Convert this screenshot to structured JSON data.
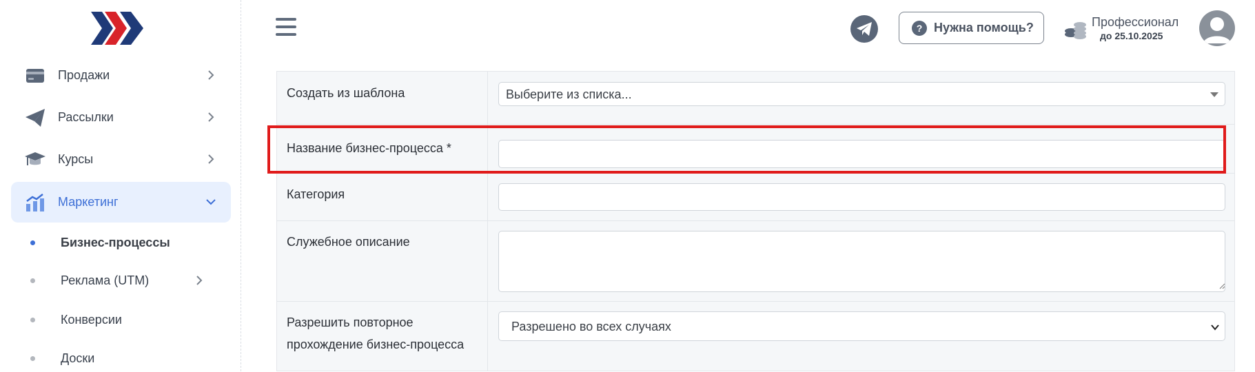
{
  "sidebar": {
    "items": [
      {
        "label": "Продажи",
        "icon": "credit-card-icon"
      },
      {
        "label": "Рассылки",
        "icon": "paper-plane-icon"
      },
      {
        "label": "Курсы",
        "icon": "graduation-cap-icon"
      },
      {
        "label": "Маркетинг",
        "icon": "chart-bar-icon"
      }
    ],
    "subitems": [
      {
        "label": "Бизнес-процессы"
      },
      {
        "label": "Реклама (UTM)"
      },
      {
        "label": "Конверсии"
      },
      {
        "label": "Доски"
      }
    ]
  },
  "header": {
    "help_label": "Нужна помощь?",
    "plan_name": "Профессионал",
    "plan_date": "до 25.10.2025"
  },
  "form": {
    "template_label": "Создать из шаблона",
    "template_value": "Выберите из списка...",
    "name_label": "Название бизнес-процесса *",
    "name_value": "",
    "category_label": "Категория",
    "category_value": "",
    "description_label": "Служебное описание",
    "description_value": "",
    "repeat_label_line1": "Разрешить повторное",
    "repeat_label_line2": "прохождение бизнес-процесса",
    "repeat_value": "Разрешено во всех случаях"
  },
  "colors": {
    "accent": "#3d6fd6",
    "active_bg": "#e8f0fe",
    "highlight": "#e01b1b",
    "logo_navy": "#1f3a78",
    "logo_red": "#d8232a"
  }
}
